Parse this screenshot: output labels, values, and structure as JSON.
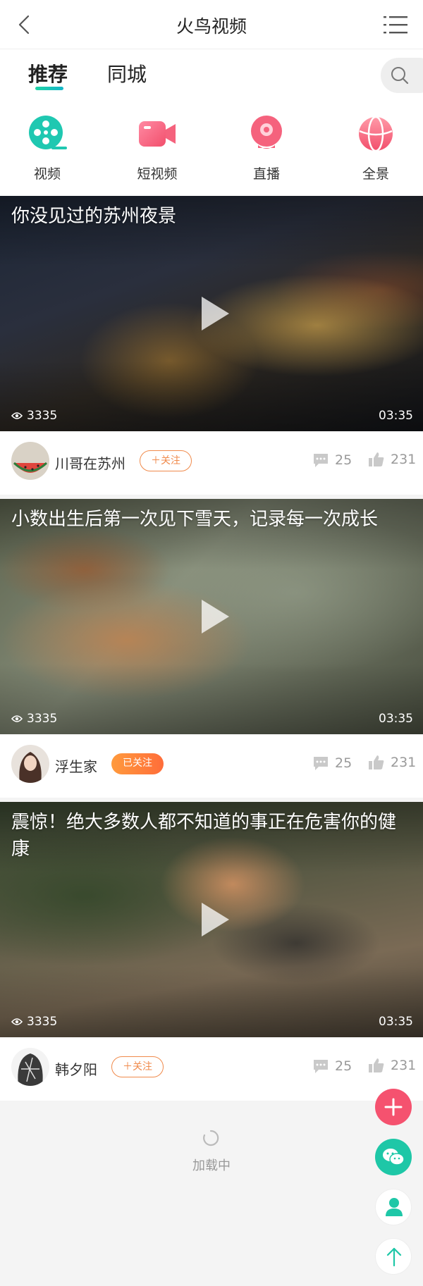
{
  "header": {
    "title": "火鸟视频"
  },
  "tabs": [
    {
      "label": "推荐",
      "active": true
    },
    {
      "label": "同城",
      "active": false
    }
  ],
  "categories": [
    {
      "label": "视频",
      "icon": "film-reel-icon",
      "color": "#1fc8b1"
    },
    {
      "label": "短视频",
      "icon": "video-camera-icon",
      "color": "#f5627d"
    },
    {
      "label": "直播",
      "icon": "webcam-live-icon",
      "color": "#f5627d"
    },
    {
      "label": "全景",
      "icon": "panorama-globe-icon",
      "color": "#f5627d"
    }
  ],
  "videos": [
    {
      "title": "你没见过的苏州夜景",
      "views": "3335",
      "duration": "03:35",
      "author": "川哥在苏州",
      "follow_label": "关注",
      "following": false,
      "comments": "25",
      "likes": "231"
    },
    {
      "title": "小数出生后第一次见下雪天，记录每一次成长",
      "views": "3335",
      "duration": "03:35",
      "author": "浮生家",
      "follow_label": "已关注",
      "following": true,
      "comments": "25",
      "likes": "231"
    },
    {
      "title": "震惊！绝大多数人都不知道的事正在危害你的健康",
      "views": "3335",
      "duration": "03:35",
      "author": "韩夕阳",
      "follow_label": "关注",
      "following": false,
      "comments": "25",
      "likes": "231"
    }
  ],
  "loading": {
    "text": "加载中"
  },
  "theme": {
    "accent": "#1fc8b1",
    "pink": "#f5627d",
    "orange": "#f08a4b"
  }
}
